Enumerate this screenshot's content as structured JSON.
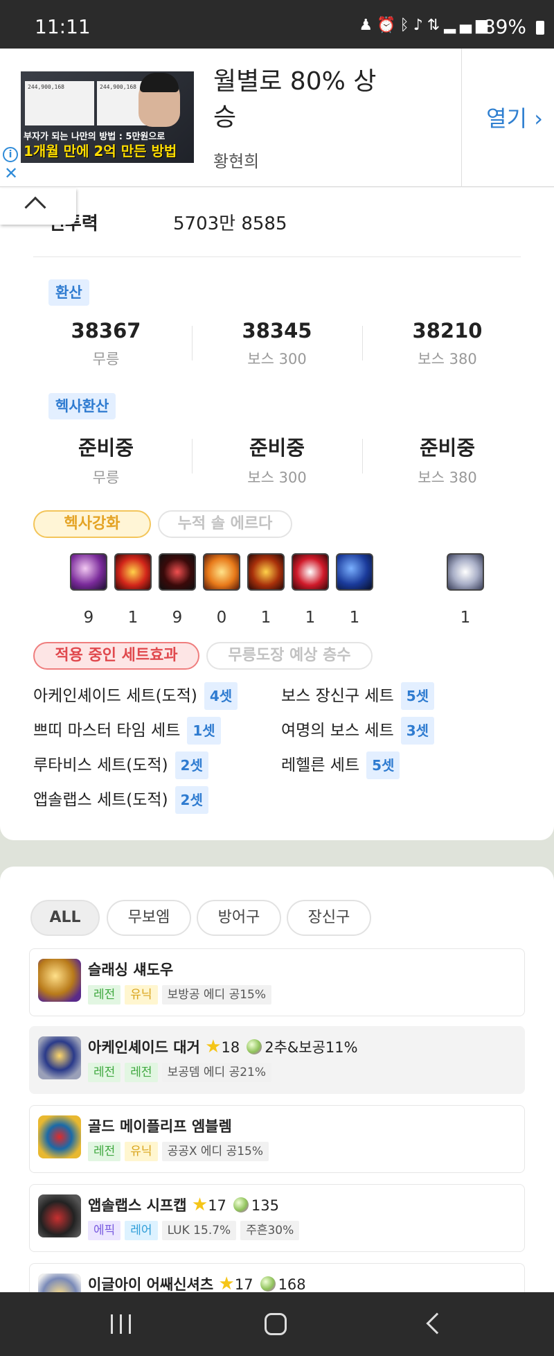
{
  "status_bar": {
    "time": "11:11",
    "icons": [
      "person-icon",
      "alarm-icon",
      "bluetooth-icon",
      "mute-icon",
      "lte-icon",
      "signal-icon"
    ],
    "battery": "89%"
  },
  "ad": {
    "thumb_line1": "부자가 되는 나만의 방법 : 5만원으로",
    "thumb_line2": "1개월 만에 2억 만든 방법",
    "thumb_panel_value": "244,900,168",
    "headline": "월별로 80% 상승",
    "advertiser": "황현희",
    "open_label": "열기"
  },
  "power": {
    "label": "전투력",
    "value": "5703만 8585"
  },
  "conversion": {
    "tag": "환산",
    "stats": [
      {
        "value": "38367",
        "label": "무릉"
      },
      {
        "value": "38345",
        "label": "보스 300"
      },
      {
        "value": "38210",
        "label": "보스 380"
      }
    ]
  },
  "hexa_conversion": {
    "tag": "헥사환산",
    "stats": [
      {
        "value": "준비중",
        "label": "무릉"
      },
      {
        "value": "준비중",
        "label": "보스 300"
      },
      {
        "value": "준비중",
        "label": "보스 380"
      }
    ]
  },
  "hexa_tabs": {
    "active": "헥사강화",
    "inactive": "누적 솔 에르다"
  },
  "skills": [
    {
      "icon": "skill-1-icon",
      "level": "9"
    },
    {
      "icon": "skill-2-icon",
      "level": "1"
    },
    {
      "icon": "skill-3-icon",
      "level": "9"
    },
    {
      "icon": "skill-4-icon",
      "level": "0"
    },
    {
      "icon": "skill-5-icon",
      "level": "1"
    },
    {
      "icon": "skill-6-icon",
      "level": "1"
    },
    {
      "icon": "skill-7-icon",
      "level": "1"
    },
    {
      "icon": "skill-8-icon",
      "level": "1"
    }
  ],
  "set_tabs": {
    "active": "적용 중인 세트효과",
    "inactive": "무릉도장 예상 층수"
  },
  "sets": [
    {
      "name": "아케인셰이드 세트(도적)",
      "count": "4셋"
    },
    {
      "name": "보스 장신구 세트",
      "count": "5셋"
    },
    {
      "name": "쁘띠 마스터 타임 세트",
      "count": "1셋"
    },
    {
      "name": "여명의 보스 세트",
      "count": "3셋"
    },
    {
      "name": "루타비스 세트(도적)",
      "count": "2셋"
    },
    {
      "name": "레헬른 세트",
      "count": "5셋"
    },
    {
      "name": "앱솔랩스 세트(도적)",
      "count": "2셋"
    }
  ],
  "filters": [
    "ALL",
    "무보엠",
    "방어구",
    "장신구"
  ],
  "items": [
    {
      "name": "슬래싱 섀도우",
      "star": "",
      "gem": "",
      "chips": [
        {
          "t": "레전",
          "c": "leg"
        },
        {
          "t": "유닉",
          "c": "uni"
        },
        {
          "t": "보방공 에디 공15%",
          "c": "pot"
        }
      ]
    },
    {
      "name": "아케인셰이드 대거",
      "star": "18",
      "gem": "2추&보공11%",
      "chips": [
        {
          "t": "레전",
          "c": "leg"
        },
        {
          "t": "레전",
          "c": "leg"
        },
        {
          "t": "보공뎀 에디 공21%",
          "c": "pot"
        }
      ]
    },
    {
      "name": "골드 메이플리프 엠블렘",
      "star": "",
      "gem": "",
      "chips": [
        {
          "t": "레전",
          "c": "leg"
        },
        {
          "t": "유닉",
          "c": "uni"
        },
        {
          "t": "공공X 에디 공15%",
          "c": "pot"
        }
      ]
    },
    {
      "name": "앱솔랩스 시프캡",
      "star": "17",
      "gem": "135",
      "chips": [
        {
          "t": "에픽",
          "c": "epi"
        },
        {
          "t": "레어",
          "c": "rare"
        },
        {
          "t": "LUK 15.7%",
          "c": "pot"
        },
        {
          "t": "주흔30%",
          "c": "pot"
        }
      ]
    },
    {
      "name": "이글아이 어쌔신셔츠",
      "star": "17",
      "gem": "168",
      "chips": []
    }
  ]
}
